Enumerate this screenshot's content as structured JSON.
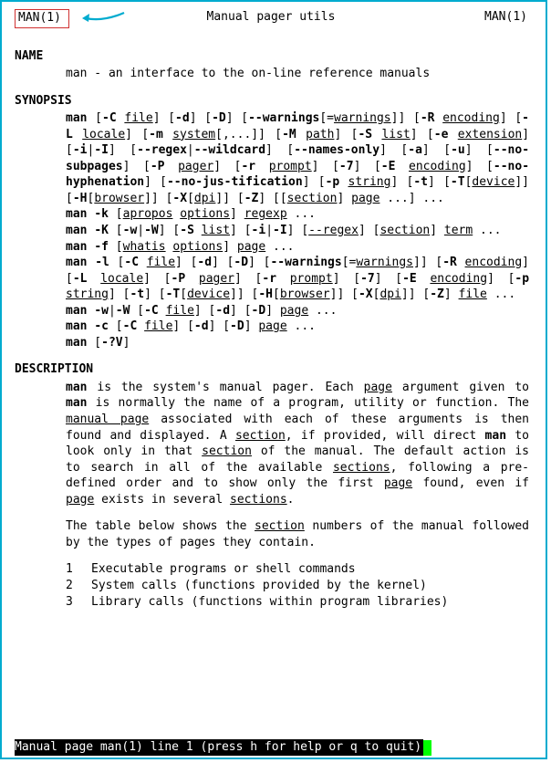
{
  "header": {
    "left": "MAN(1)",
    "center": "Manual pager utils",
    "right": "MAN(1)"
  },
  "sections": {
    "name_title": "NAME",
    "name_text": "man - an interface to the on-line reference manuals",
    "synopsis_title": "SYNOPSIS",
    "description_title": "DESCRIPTION"
  },
  "syn": {
    "cmd": "man",
    "C": "-C",
    "file": "file",
    "d": "-d",
    "D": "-D",
    "warnings": "--warnings",
    "warnings_arg": "warnings",
    "R": "-R",
    "encoding": "encoding",
    "L": "-L",
    "locale": "locale",
    "m": "-m",
    "system": "system",
    "sys_tail": "[,...]]",
    "M": "-M",
    "path": "path",
    "S": "-S",
    "list": "list",
    "e": "-e",
    "extension": "extension",
    "iI": "-i",
    "I": "-I",
    "regex": "--regex",
    "wildcard": "--wildcard",
    "names_only": "--names-only",
    "a": "-a",
    "u": "-u",
    "no_subpages": "--no-subpages",
    "P": "-P",
    "pager": "pager",
    "r": "-r",
    "prompt": "prompt",
    "seven": "-7",
    "E": "-E",
    "no_hyph": "--no-hyphenation",
    "no_just": "--no-jus-",
    "no_just2": "tification",
    "p": "-p",
    "string": "string",
    "t": "-t",
    "T": "-T",
    "device": "device",
    "H": "-H",
    "browser": "browser",
    "X": "-X",
    "dpi": "dpi",
    "Z": "-Z",
    "section": "section",
    "page": "page",
    "k": "-k",
    "apropos": "apropos",
    "options": "options",
    "regexp": "regexp",
    "K": "-K",
    "w": "-w",
    "W": "-W",
    "regex2": "--regex",
    "term": "term",
    "f": "-f",
    "whatis": "whatis",
    "l": "-l",
    "wW": "-w",
    "W2": "-W",
    "c": "-c",
    "qV": "-?V",
    "dots": "..."
  },
  "desc": {
    "p1_man": "man",
    "p1_a": " is the system's manual pager. Each ",
    "p1_page": "page",
    "p1_b": " argument given to ",
    "p1_man2": "man",
    "p1_c": " is normally the name of a program, utility or function.  The ",
    "p1_manpage": "manual page",
    "p1_d": " associated with each of these arguments is then found and displayed. A ",
    "p1_section": "section",
    "p1_e": ", if provided, will direct ",
    "p1_man3": "man",
    "p1_f": " to look only in that ",
    "p1_sec2": "sec",
    "p1_sec2b": "tion",
    "p1_g": " of the manual.  The default action is to search in all of the available ",
    "p1_sections": "sections",
    "p1_h": ", following a pre-defined order and to show only the first ",
    "p1_page2": "page",
    "p1_i": " found, even if ",
    "p1_page3": "page",
    "p1_j": " exists in several ",
    "p1_sections2": "sections",
    "p1_k": ".",
    "p2_a": "The table below shows the ",
    "p2_section": "section",
    "p2_b": " numbers of the manual followed by the types of pages they contain."
  },
  "list": [
    {
      "n": "1",
      "t": "Executable programs or shell commands"
    },
    {
      "n": "2",
      "t": "System calls (functions provided by the kernel)"
    },
    {
      "n": "3",
      "t": "Library calls (functions within program libraries)"
    }
  ],
  "status": "Manual page man(1) line 1 (press h for help or q to quit)"
}
